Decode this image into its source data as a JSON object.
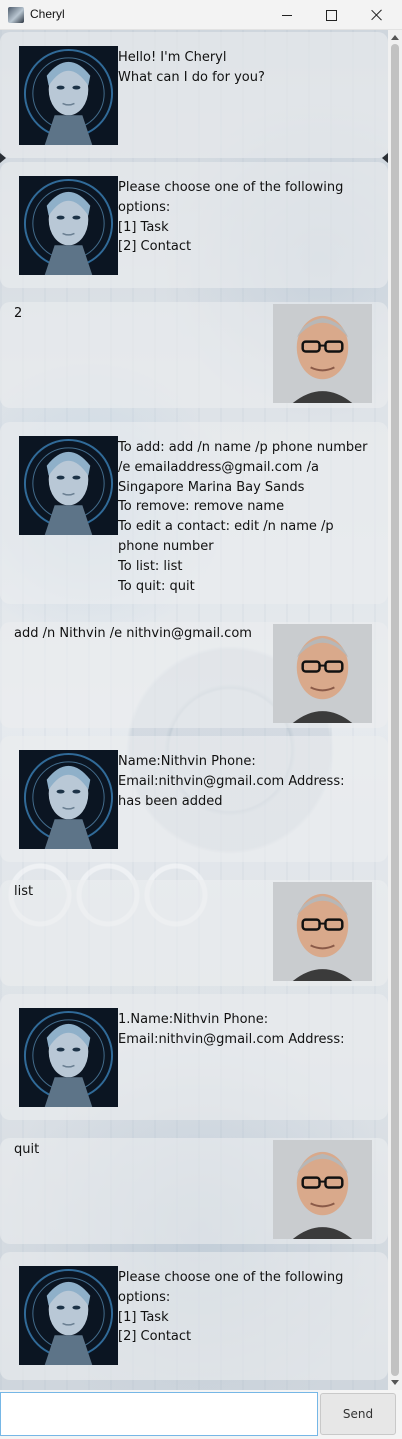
{
  "window": {
    "title": "Cheryl"
  },
  "chat": {
    "messages": [
      {
        "sender": "bot",
        "avatar": "cheryl-robot-avatar",
        "text": "Hello! I'm Cheryl\nWhat can I do for you?"
      },
      {
        "sender": "bot",
        "avatar": "cheryl-robot-avatar",
        "text": "Please choose one of the following options:\n[1] Task\n[2] Contact"
      },
      {
        "sender": "user",
        "avatar": "user-photo-avatar",
        "text": "2"
      },
      {
        "sender": "bot",
        "avatar": "cheryl-robot-avatar",
        "text": "To add: add /n name /p phone number /e emailaddress@gmail.com /a Singapore Marina Bay Sands\nTo remove: remove name\nTo edit a contact: edit /n name /p phone number\nTo list: list\nTo quit: quit"
      },
      {
        "sender": "user",
        "avatar": "user-photo-avatar",
        "text": "add /n Nithvin /e nithvin@gmail.com"
      },
      {
        "sender": "bot",
        "avatar": "cheryl-robot-avatar",
        "text": "Name:Nithvin Phone: Email:nithvin@gmail.com Address: has been added"
      },
      {
        "sender": "user",
        "avatar": "user-photo-avatar",
        "text": "list"
      },
      {
        "sender": "bot",
        "avatar": "cheryl-robot-avatar",
        "text": "1.Name:Nithvin Phone: Email:nithvin@gmail.com Address:"
      },
      {
        "sender": "user",
        "avatar": "user-photo-avatar",
        "text": "quit"
      },
      {
        "sender": "bot",
        "avatar": "cheryl-robot-avatar",
        "text": "Please choose one of the following options:\n[1] Task\n[2] Contact"
      }
    ]
  },
  "input": {
    "value": "",
    "placeholder": ""
  },
  "send": {
    "label": "Send"
  },
  "colors": {
    "input_border": "#76b7e6",
    "button_bg": "#e7e7e7",
    "titlebar_bg": "#f3f3f3"
  }
}
